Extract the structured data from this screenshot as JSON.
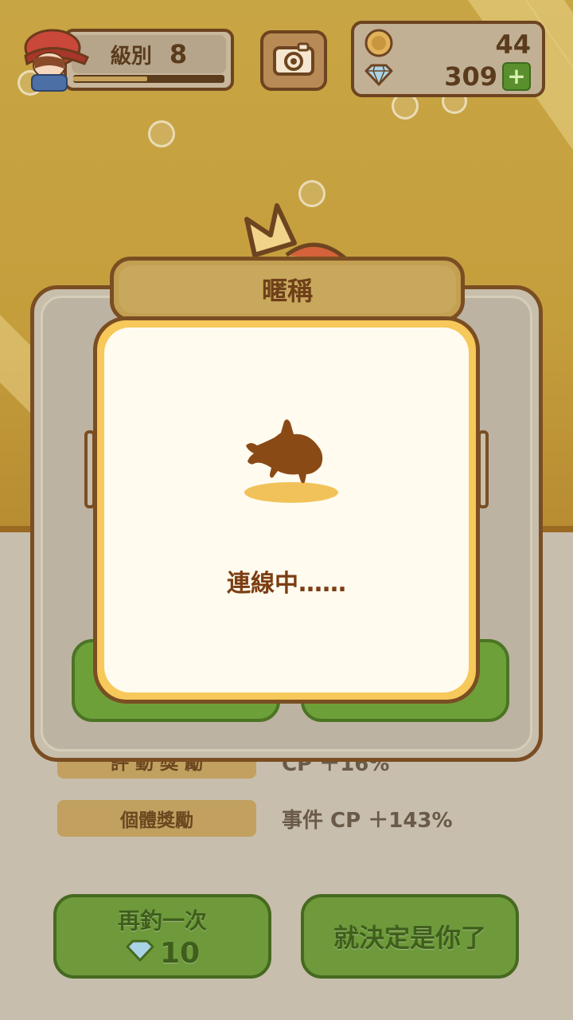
{
  "hud": {
    "level_label": "級別",
    "level_value": "8",
    "xp_progress": 0.49,
    "coins": "44",
    "gems": "309",
    "plus_label": "+"
  },
  "dialog": {
    "title": "暱稱"
  },
  "popup": {
    "status_text": "連線中……"
  },
  "bonus": {
    "partial_label": "評 動 獎 勵",
    "partial_value": "CP ＋16%",
    "individual_label": "個體獎勵",
    "individual_value": "事件 CP ＋143%"
  },
  "buttons": {
    "again_label": "再釣一次",
    "again_cost": "10",
    "decide_label": "就決定是你了"
  },
  "colors": {
    "accent_brown": "#7a4e22",
    "green_button": "#6e9a3c",
    "popup_border": "#f7c85a"
  },
  "icons": {
    "coin": "coin-icon",
    "gem": "diamond-icon",
    "camera": "camera-icon",
    "fish": "fish-silhouette-icon"
  }
}
